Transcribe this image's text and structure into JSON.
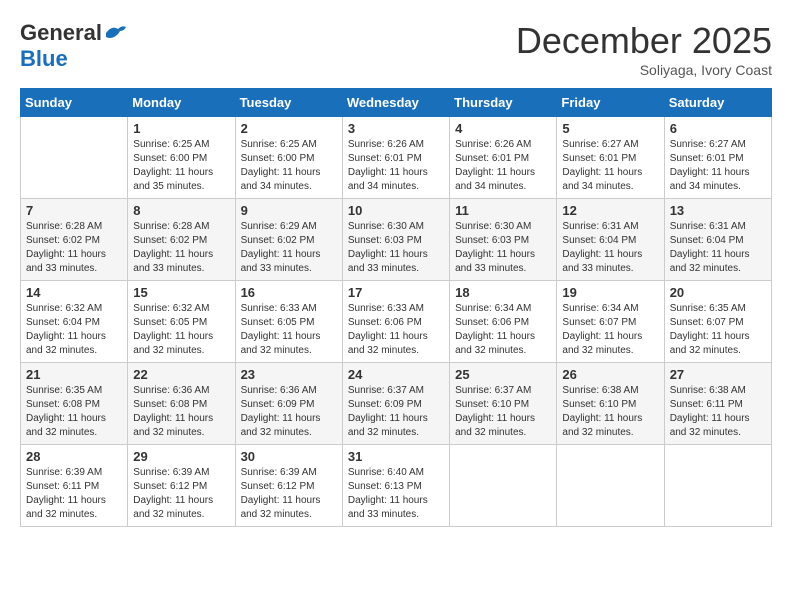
{
  "header": {
    "logo_general": "General",
    "logo_blue": "Blue",
    "month": "December 2025",
    "location": "Soliyaga, Ivory Coast"
  },
  "days_of_week": [
    "Sunday",
    "Monday",
    "Tuesday",
    "Wednesday",
    "Thursday",
    "Friday",
    "Saturday"
  ],
  "weeks": [
    [
      {
        "day": "",
        "info": ""
      },
      {
        "day": "1",
        "info": "Sunrise: 6:25 AM\nSunset: 6:00 PM\nDaylight: 11 hours\nand 35 minutes."
      },
      {
        "day": "2",
        "info": "Sunrise: 6:25 AM\nSunset: 6:00 PM\nDaylight: 11 hours\nand 34 minutes."
      },
      {
        "day": "3",
        "info": "Sunrise: 6:26 AM\nSunset: 6:01 PM\nDaylight: 11 hours\nand 34 minutes."
      },
      {
        "day": "4",
        "info": "Sunrise: 6:26 AM\nSunset: 6:01 PM\nDaylight: 11 hours\nand 34 minutes."
      },
      {
        "day": "5",
        "info": "Sunrise: 6:27 AM\nSunset: 6:01 PM\nDaylight: 11 hours\nand 34 minutes."
      },
      {
        "day": "6",
        "info": "Sunrise: 6:27 AM\nSunset: 6:01 PM\nDaylight: 11 hours\nand 34 minutes."
      }
    ],
    [
      {
        "day": "7",
        "info": "Sunrise: 6:28 AM\nSunset: 6:02 PM\nDaylight: 11 hours\nand 33 minutes."
      },
      {
        "day": "8",
        "info": "Sunrise: 6:28 AM\nSunset: 6:02 PM\nDaylight: 11 hours\nand 33 minutes."
      },
      {
        "day": "9",
        "info": "Sunrise: 6:29 AM\nSunset: 6:02 PM\nDaylight: 11 hours\nand 33 minutes."
      },
      {
        "day": "10",
        "info": "Sunrise: 6:30 AM\nSunset: 6:03 PM\nDaylight: 11 hours\nand 33 minutes."
      },
      {
        "day": "11",
        "info": "Sunrise: 6:30 AM\nSunset: 6:03 PM\nDaylight: 11 hours\nand 33 minutes."
      },
      {
        "day": "12",
        "info": "Sunrise: 6:31 AM\nSunset: 6:04 PM\nDaylight: 11 hours\nand 33 minutes."
      },
      {
        "day": "13",
        "info": "Sunrise: 6:31 AM\nSunset: 6:04 PM\nDaylight: 11 hours\nand 32 minutes."
      }
    ],
    [
      {
        "day": "14",
        "info": "Sunrise: 6:32 AM\nSunset: 6:04 PM\nDaylight: 11 hours\nand 32 minutes."
      },
      {
        "day": "15",
        "info": "Sunrise: 6:32 AM\nSunset: 6:05 PM\nDaylight: 11 hours\nand 32 minutes."
      },
      {
        "day": "16",
        "info": "Sunrise: 6:33 AM\nSunset: 6:05 PM\nDaylight: 11 hours\nand 32 minutes."
      },
      {
        "day": "17",
        "info": "Sunrise: 6:33 AM\nSunset: 6:06 PM\nDaylight: 11 hours\nand 32 minutes."
      },
      {
        "day": "18",
        "info": "Sunrise: 6:34 AM\nSunset: 6:06 PM\nDaylight: 11 hours\nand 32 minutes."
      },
      {
        "day": "19",
        "info": "Sunrise: 6:34 AM\nSunset: 6:07 PM\nDaylight: 11 hours\nand 32 minutes."
      },
      {
        "day": "20",
        "info": "Sunrise: 6:35 AM\nSunset: 6:07 PM\nDaylight: 11 hours\nand 32 minutes."
      }
    ],
    [
      {
        "day": "21",
        "info": "Sunrise: 6:35 AM\nSunset: 6:08 PM\nDaylight: 11 hours\nand 32 minutes."
      },
      {
        "day": "22",
        "info": "Sunrise: 6:36 AM\nSunset: 6:08 PM\nDaylight: 11 hours\nand 32 minutes."
      },
      {
        "day": "23",
        "info": "Sunrise: 6:36 AM\nSunset: 6:09 PM\nDaylight: 11 hours\nand 32 minutes."
      },
      {
        "day": "24",
        "info": "Sunrise: 6:37 AM\nSunset: 6:09 PM\nDaylight: 11 hours\nand 32 minutes."
      },
      {
        "day": "25",
        "info": "Sunrise: 6:37 AM\nSunset: 6:10 PM\nDaylight: 11 hours\nand 32 minutes."
      },
      {
        "day": "26",
        "info": "Sunrise: 6:38 AM\nSunset: 6:10 PM\nDaylight: 11 hours\nand 32 minutes."
      },
      {
        "day": "27",
        "info": "Sunrise: 6:38 AM\nSunset: 6:11 PM\nDaylight: 11 hours\nand 32 minutes."
      }
    ],
    [
      {
        "day": "28",
        "info": "Sunrise: 6:39 AM\nSunset: 6:11 PM\nDaylight: 11 hours\nand 32 minutes."
      },
      {
        "day": "29",
        "info": "Sunrise: 6:39 AM\nSunset: 6:12 PM\nDaylight: 11 hours\nand 32 minutes."
      },
      {
        "day": "30",
        "info": "Sunrise: 6:39 AM\nSunset: 6:12 PM\nDaylight: 11 hours\nand 32 minutes."
      },
      {
        "day": "31",
        "info": "Sunrise: 6:40 AM\nSunset: 6:13 PM\nDaylight: 11 hours\nand 33 minutes."
      },
      {
        "day": "",
        "info": ""
      },
      {
        "day": "",
        "info": ""
      },
      {
        "day": "",
        "info": ""
      }
    ]
  ]
}
